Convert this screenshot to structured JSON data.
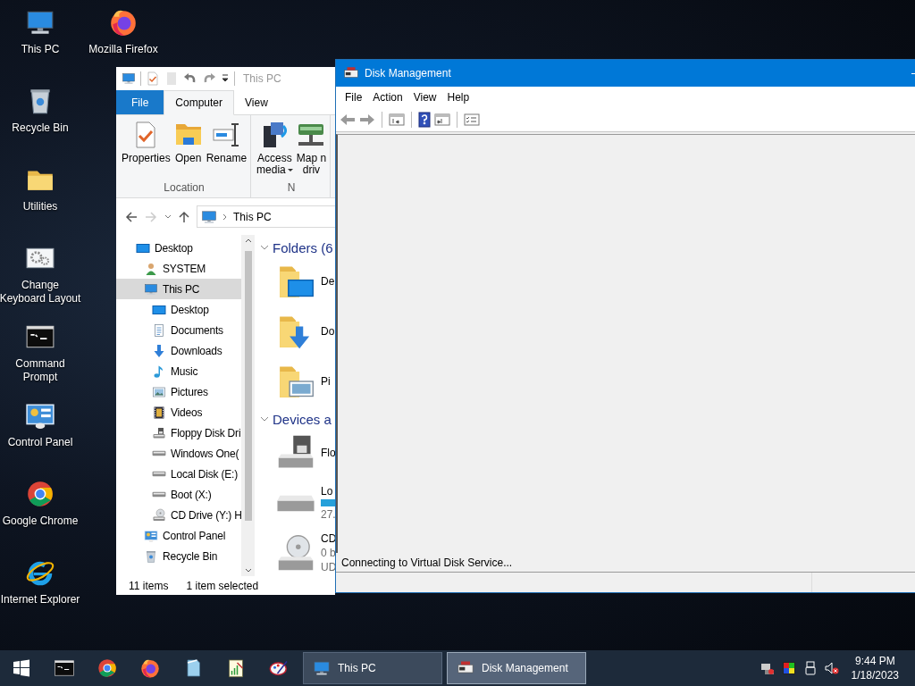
{
  "desktop_icons": [
    {
      "lines": [
        "This PC"
      ],
      "kind": "pc"
    },
    {
      "lines": [
        "Recycle Bin"
      ],
      "kind": "recycle"
    },
    {
      "lines": [
        "Utilities"
      ],
      "kind": "folder"
    },
    {
      "lines": [
        "Change",
        "Keyboard Layout"
      ],
      "kind": "keyboard"
    },
    {
      "lines": [
        "Command",
        "Prompt"
      ],
      "kind": "cmd"
    },
    {
      "lines": [
        "Control Panel"
      ],
      "kind": "control"
    },
    {
      "lines": [
        "Google Chrome"
      ],
      "kind": "chrome"
    },
    {
      "lines": [
        "Internet Explorer"
      ],
      "kind": "ie"
    },
    {
      "lines": [
        "Mozilla Firefox"
      ],
      "kind": "firefox"
    }
  ],
  "explorer": {
    "title": "This PC",
    "tabs": [
      {
        "label": "File",
        "kind": "file",
        "selected": false
      },
      {
        "label": "Computer",
        "kind": "tab",
        "selected": true
      },
      {
        "label": "View",
        "kind": "tab",
        "selected": false
      }
    ],
    "ribbon_groups": [
      {
        "label": "Location",
        "buttons": [
          {
            "lines": [
              "Properties"
            ],
            "kind": "properties",
            "dropdown": false
          },
          {
            "lines": [
              "Open"
            ],
            "kind": "open",
            "dropdown": false
          },
          {
            "lines": [
              "Rename"
            ],
            "kind": "rename",
            "dropdown": false
          }
        ]
      },
      {
        "label": "N",
        "buttons": [
          {
            "lines": [
              "Access",
              "media"
            ],
            "kind": "media",
            "dropdown": true
          },
          {
            "lines": [
              "Map n",
              "driv"
            ],
            "kind": "netdrive",
            "dropdown": false
          }
        ]
      }
    ],
    "address": "This PC",
    "nav_tree": [
      {
        "label": "Desktop",
        "kind": "desktop",
        "selected": false,
        "children": [
          {
            "label": "SYSTEM",
            "kind": "user",
            "selected": false
          },
          {
            "label": "This PC",
            "kind": "pc",
            "selected": true,
            "children": [
              {
                "label": "Desktop",
                "kind": "desktop",
                "selected": false
              },
              {
                "label": "Documents",
                "kind": "docs",
                "selected": false
              },
              {
                "label": "Downloads",
                "kind": "down",
                "selected": false
              },
              {
                "label": "Music",
                "kind": "music",
                "selected": false
              },
              {
                "label": "Pictures",
                "kind": "pics",
                "selected": false
              },
              {
                "label": "Videos",
                "kind": "videos",
                "selected": false
              },
              {
                "label": "Floppy Disk Dri",
                "kind": "floppy-small",
                "selected": false
              },
              {
                "label": "Windows One(",
                "kind": "drive-small",
                "selected": false
              },
              {
                "label": "Local Disk (E:)",
                "kind": "drive-small",
                "selected": false
              },
              {
                "label": "Boot (X:)",
                "kind": "drive-small",
                "selected": false
              },
              {
                "label": "CD Drive (Y:) H",
                "kind": "cd-small",
                "selected": false
              }
            ]
          },
          {
            "label": "Control Panel",
            "kind": "control",
            "selected": false
          },
          {
            "label": "Recycle Bin",
            "kind": "recycle",
            "selected": false
          }
        ]
      }
    ],
    "groups": [
      {
        "title": "Folders (6",
        "expanded": true,
        "items": [
          {
            "name": "De",
            "kind": "desktop-folder"
          },
          {
            "name": "Do",
            "kind": "downloads-folder"
          },
          {
            "name": "Pi",
            "kind": "pictures-folder"
          }
        ]
      },
      {
        "title": "Devices a",
        "expanded": true,
        "items": [
          {
            "name": "Flo",
            "kind": "floppy"
          },
          {
            "name": "Lo",
            "kind": "local-disk",
            "details": [
              "27."
            ]
          },
          {
            "name": "CD",
            "kind": "cd",
            "details": [
              "0 b",
              "UD"
            ]
          }
        ]
      }
    ],
    "status": {
      "count": "11 items",
      "selection": "1 item selected"
    }
  },
  "disk_management": {
    "title": "Disk Management",
    "menu": [
      "File",
      "Action",
      "View",
      "Help"
    ],
    "status": "Connecting to Virtual Disk Service..."
  },
  "taskbar": {
    "pinned": [
      {
        "kind": "cmd"
      },
      {
        "kind": "chrome"
      },
      {
        "kind": "firefox"
      },
      {
        "kind": "notepad"
      },
      {
        "kind": "sheet"
      },
      {
        "kind": "paint"
      }
    ],
    "windows": [
      {
        "label": "This PC",
        "kind": "pc",
        "selected": false
      },
      {
        "label": "Disk Management",
        "kind": "diskmgmt",
        "selected": true
      }
    ],
    "time": "9:44 PM",
    "date": "1/18/2023"
  }
}
